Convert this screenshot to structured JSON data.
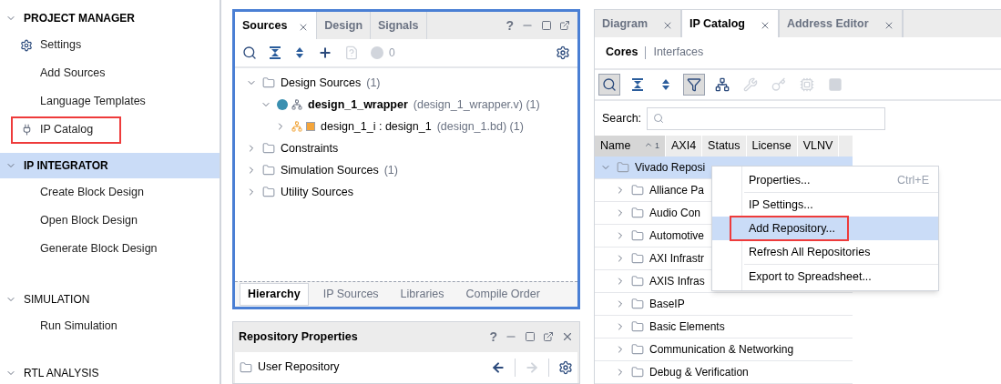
{
  "sidebar": {
    "sections": [
      {
        "title": "PROJECT MANAGER",
        "expanded": true,
        "selected": false,
        "items": [
          {
            "label": "Settings",
            "kind": "settings",
            "highlighted": false
          },
          {
            "label": "Add Sources",
            "kind": "action",
            "highlighted": false
          },
          {
            "label": "Language Templates",
            "kind": "action",
            "highlighted": false
          },
          {
            "label": "IP Catalog",
            "kind": "ip",
            "highlighted": true
          }
        ]
      },
      {
        "title": "IP INTEGRATOR",
        "expanded": true,
        "selected": true,
        "items": [
          {
            "label": "Create Block Design",
            "kind": "action",
            "highlighted": false
          },
          {
            "label": "Open Block Design",
            "kind": "action",
            "highlighted": false
          },
          {
            "label": "Generate Block Design",
            "kind": "action",
            "highlighted": false
          }
        ]
      },
      {
        "title": "SIMULATION",
        "expanded": true,
        "selected": false,
        "items": [
          {
            "label": "Run Simulation",
            "kind": "action",
            "highlighted": false
          }
        ]
      },
      {
        "title": "RTL ANALYSIS",
        "expanded": true,
        "selected": false
      }
    ]
  },
  "sources_panel": {
    "tabs": [
      {
        "label": "Sources",
        "selected": true
      },
      {
        "label": "Design",
        "selected": false
      },
      {
        "label": "Signals",
        "selected": false
      }
    ],
    "help": "?",
    "error_count": "0",
    "tree": [
      {
        "label": "Design Sources",
        "suffix": "(1)",
        "bold": false,
        "kind": "folder",
        "expanded": true,
        "children": [
          {
            "label": "design_1_wrapper",
            "suffix": "(design_1_wrapper.v) (1)",
            "bold": true,
            "kind": "module",
            "expanded": true,
            "children": [
              {
                "label": "design_1_i : design_1",
                "suffix": "(design_1.bd) (1)",
                "bold": false,
                "kind": "block",
                "expanded": false
              }
            ]
          }
        ]
      },
      {
        "label": "Constraints",
        "bold": false,
        "kind": "folder",
        "expanded": false
      },
      {
        "label": "Simulation Sources",
        "suffix": "(1)",
        "bold": false,
        "kind": "folder",
        "expanded": false
      },
      {
        "label": "Utility Sources",
        "bold": false,
        "kind": "folder",
        "expanded": false
      }
    ],
    "bottom_tabs": [
      {
        "label": "Hierarchy",
        "selected": true
      },
      {
        "label": "IP Sources",
        "selected": false
      },
      {
        "label": "Libraries",
        "selected": false
      },
      {
        "label": "Compile Order",
        "selected": false
      }
    ]
  },
  "repository_panel": {
    "title": "Repository Properties",
    "help": "?",
    "item": "User Repository"
  },
  "catalog_panel": {
    "tabs": [
      {
        "label": "Diagram",
        "selected": false
      },
      {
        "label": "IP Catalog",
        "selected": true
      },
      {
        "label": "Address Editor",
        "selected": false
      }
    ],
    "subtabs": [
      {
        "label": "Cores",
        "selected": true
      },
      {
        "label": "Interfaces",
        "selected": false
      }
    ],
    "toolbar": [
      {
        "pressed": true,
        "disabled": false
      },
      {
        "pressed": false,
        "disabled": false
      },
      {
        "pressed": false,
        "disabled": false
      },
      {
        "pressed": true,
        "disabled": false
      },
      {
        "pressed": false,
        "disabled": false
      },
      {
        "pressed": false,
        "disabled": true
      },
      {
        "pressed": false,
        "disabled": true
      },
      {
        "pressed": false,
        "disabled": true
      },
      {
        "pressed": false,
        "disabled": true
      }
    ],
    "search_label": "Search:",
    "columns": [
      {
        "label": "Name",
        "sort": "1"
      },
      {
        "label": "AXI4"
      },
      {
        "label": "Status"
      },
      {
        "label": "License"
      },
      {
        "label": "VLNV"
      }
    ],
    "rows": [
      {
        "label": "Vivado Reposi",
        "expanded": true,
        "selected": true,
        "children": [
          {
            "label": "Alliance Pa",
            "expanded": false,
            "selected": false
          },
          {
            "label": "Audio Con",
            "expanded": false,
            "selected": false
          },
          {
            "label": "Automotive",
            "expanded": false,
            "selected": false
          },
          {
            "label": "AXI Infrastr",
            "expanded": false,
            "selected": false
          },
          {
            "label": "AXIS Infras",
            "expanded": false,
            "selected": false
          },
          {
            "label": "BaseIP",
            "expanded": false,
            "selected": false
          },
          {
            "label": "Basic Elements",
            "expanded": false,
            "selected": false
          },
          {
            "label": "Communication & Networking",
            "expanded": false,
            "selected": false
          },
          {
            "label": "Debug & Verification",
            "expanded": false,
            "selected": false
          }
        ]
      }
    ],
    "context_menu": {
      "groups": [
        [
          {
            "label": "Properties...",
            "shortcut": "Ctrl+E",
            "selected": false,
            "highlighted": false
          }
        ],
        [
          {
            "label": "IP Settings...",
            "selected": false,
            "highlighted": false
          },
          {
            "label": "Add Repository...",
            "selected": true,
            "highlighted": true
          },
          {
            "label": "Refresh All Repositories",
            "selected": false,
            "highlighted": false
          }
        ],
        [
          {
            "label": "Export to Spreadsheet...",
            "selected": false,
            "highlighted": false
          }
        ]
      ]
    }
  }
}
